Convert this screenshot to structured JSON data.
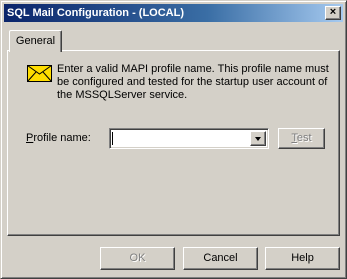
{
  "window": {
    "title": "SQL Mail Configuration - (LOCAL)",
    "close_glyph": "×"
  },
  "tabs": [
    {
      "label": "General",
      "selected": true
    }
  ],
  "general": {
    "info_icon": "envelope-icon",
    "info_text": "Enter a valid MAPI profile name.  This profile name must be configured and tested for the startup user account of the MSSQLServer service.",
    "profile_label_mnemonic": "P",
    "profile_label_rest": "rofile name:",
    "profile_value": "",
    "test_mnemonic": "T",
    "test_rest": "est",
    "test_enabled": false
  },
  "footer": {
    "ok_label": "OK",
    "ok_enabled": false,
    "cancel_label": "Cancel",
    "help_label": "Help"
  },
  "colors": {
    "face": "#d4d0c8",
    "title_start": "#0a246a",
    "title_end": "#a6caf0",
    "envelope": "#ffdd00"
  }
}
